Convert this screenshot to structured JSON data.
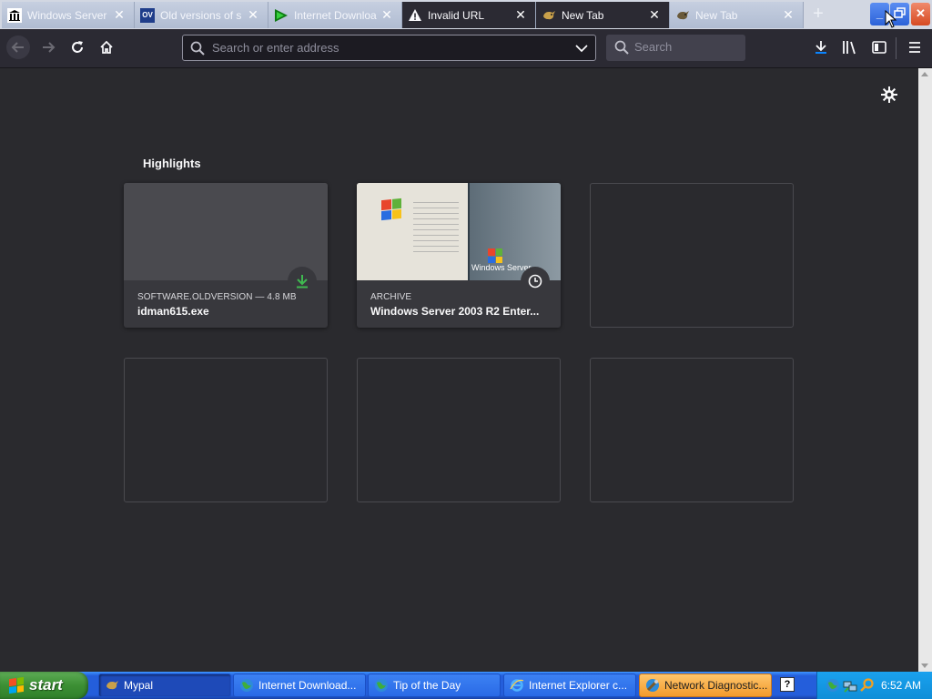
{
  "tabs": [
    {
      "label": "Windows Server",
      "icon": "archive-icon"
    },
    {
      "label": "Old versions of s",
      "icon": "oldversion-icon",
      "icon_text": "OV"
    },
    {
      "label": "Internet Downloa",
      "icon": "idm-icon"
    },
    {
      "label": "Invalid URL",
      "icon": "warning-icon"
    },
    {
      "label": "New Tab",
      "icon": "firefox-pet-icon"
    },
    {
      "label": "New Tab",
      "icon": "firefox-pet-icon"
    }
  ],
  "toolbar": {
    "url_placeholder": "Search or enter address",
    "search_placeholder": "Search"
  },
  "newtab": {
    "highlights_title": "Highlights",
    "cards": [
      {
        "context": "SOFTWARE.OLDVERSION — 4.8 MB",
        "title": "idman615.exe",
        "badge": "download-icon"
      },
      {
        "context": "ARCHIVE",
        "title": "Windows Server 2003 R2 Enter...",
        "badge": "clock-icon",
        "thumb_caption": "Windows Server"
      }
    ]
  },
  "taskbar": {
    "start_label": "start",
    "tasks": [
      {
        "label": "Mypal",
        "icon": "mypal-icon"
      },
      {
        "label": "Internet Download...",
        "icon": "idm-globe-icon"
      },
      {
        "label": "Tip of the Day",
        "icon": "tip-globe-icon"
      },
      {
        "label": "Internet Explorer c...",
        "icon": "ie-icon"
      },
      {
        "label": "Network Diagnostic...",
        "icon": "network-diag-icon"
      }
    ],
    "help_label": "?",
    "clock": "6:52 AM"
  },
  "colors": {
    "content_bg": "#2a2a2e",
    "toolbar_bg": "#2b2a33",
    "download_green": "#3fb950",
    "taskbar_blue": "#245edb",
    "start_green": "#3c8f34"
  }
}
